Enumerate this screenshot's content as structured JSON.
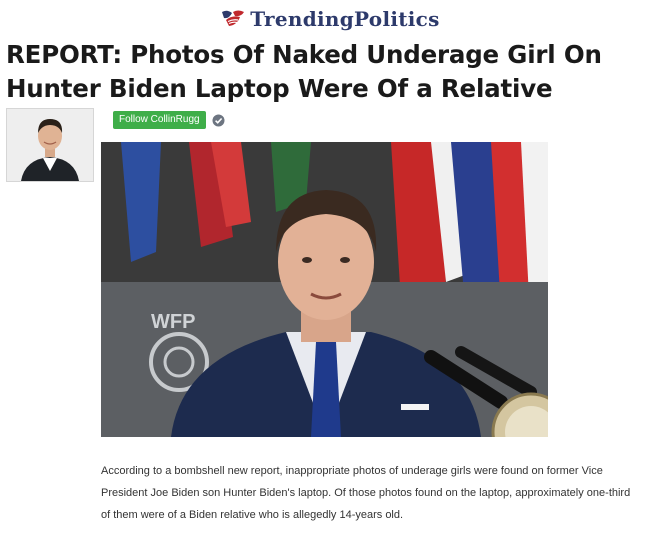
{
  "site": {
    "name": "TrendingPolitics",
    "logo_icon": "flag-logo-icon"
  },
  "article": {
    "headline": "REPORT: Photos Of Naked Underage Girl On Hunter Biden Laptop Were Of a Relative",
    "body": "According to a bombshell new report, inappropriate photos of underage girls were found on former Vice President Joe Biden son Hunter Biden's laptop. Of those photos found on the laptop, approximately one-third of them were of a Biden relative who is allegedly 14-years old."
  },
  "author": {
    "follow_label": "Follow CollinRugg",
    "verified_icon": "verified-check-icon"
  },
  "hero": {
    "wfp_label": "WFP"
  }
}
